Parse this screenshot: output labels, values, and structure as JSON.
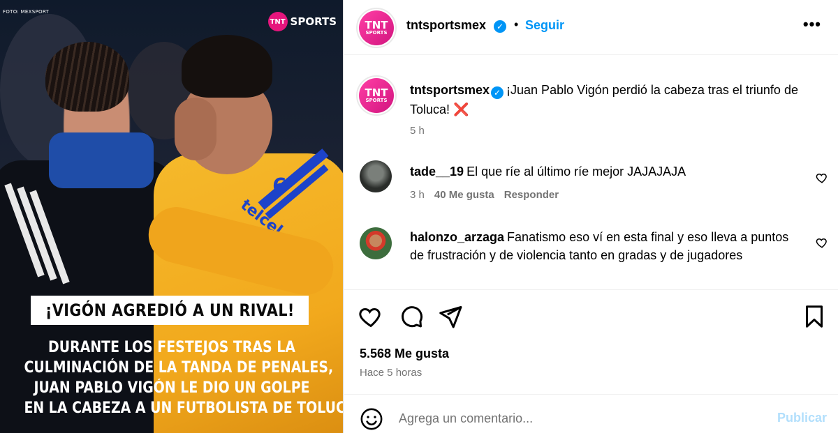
{
  "media": {
    "photo_credit": "FOTO: MEXSPORT",
    "brand_logo_text": "TNT",
    "brand_text": "SPORTS",
    "shirt_sponsor": "telcel",
    "shirt_number": "6",
    "headline": "¡VIGÓN AGREDIÓ A UN RIVAL!",
    "body_lines": [
      "DURANTE LOS FESTEJOS TRAS LA",
      "CULMINACIÓN DE LA TANDA DE PENALES,",
      "JUAN PABLO VIGÓN LE DIO UN GOLPE",
      "EN LA CABEZA A UN FUTBOLISTA DE TOLUCA."
    ]
  },
  "header": {
    "avatar_text": "TNT",
    "avatar_subtext": "SPORTS",
    "username": "tntsportsmex",
    "separator": "•",
    "follow_label": "Seguir",
    "more_label": "•••"
  },
  "caption": {
    "username": "tntsportsmex",
    "text": "¡Juan Pablo Vigón perdió la cabeza tras el triunfo de Toluca!",
    "emoji": "❌",
    "time": "5 h"
  },
  "comments": [
    {
      "username": "tade__19",
      "text": "El que ríe al último ríe mejor JAJAJAJA",
      "time": "3 h",
      "likes": "40 Me gusta",
      "reply_label": "Responder"
    },
    {
      "username": "halonzo_arzaga",
      "text": "Fanatismo eso ví en esta final y eso lleva a puntos de frustración y de violencia tanto en gradas y de jugadores"
    }
  ],
  "actions": {
    "like_count": "5.568 Me gusta",
    "post_time": "Hace 5 horas"
  },
  "add_comment": {
    "placeholder": "Agrega un comentario...",
    "publish_label": "Publicar"
  },
  "colors": {
    "accent_blue": "#0095f6",
    "brand_pink": "#e6157d",
    "publish_disabled": "#b2dffc",
    "muted_text": "#737373"
  }
}
